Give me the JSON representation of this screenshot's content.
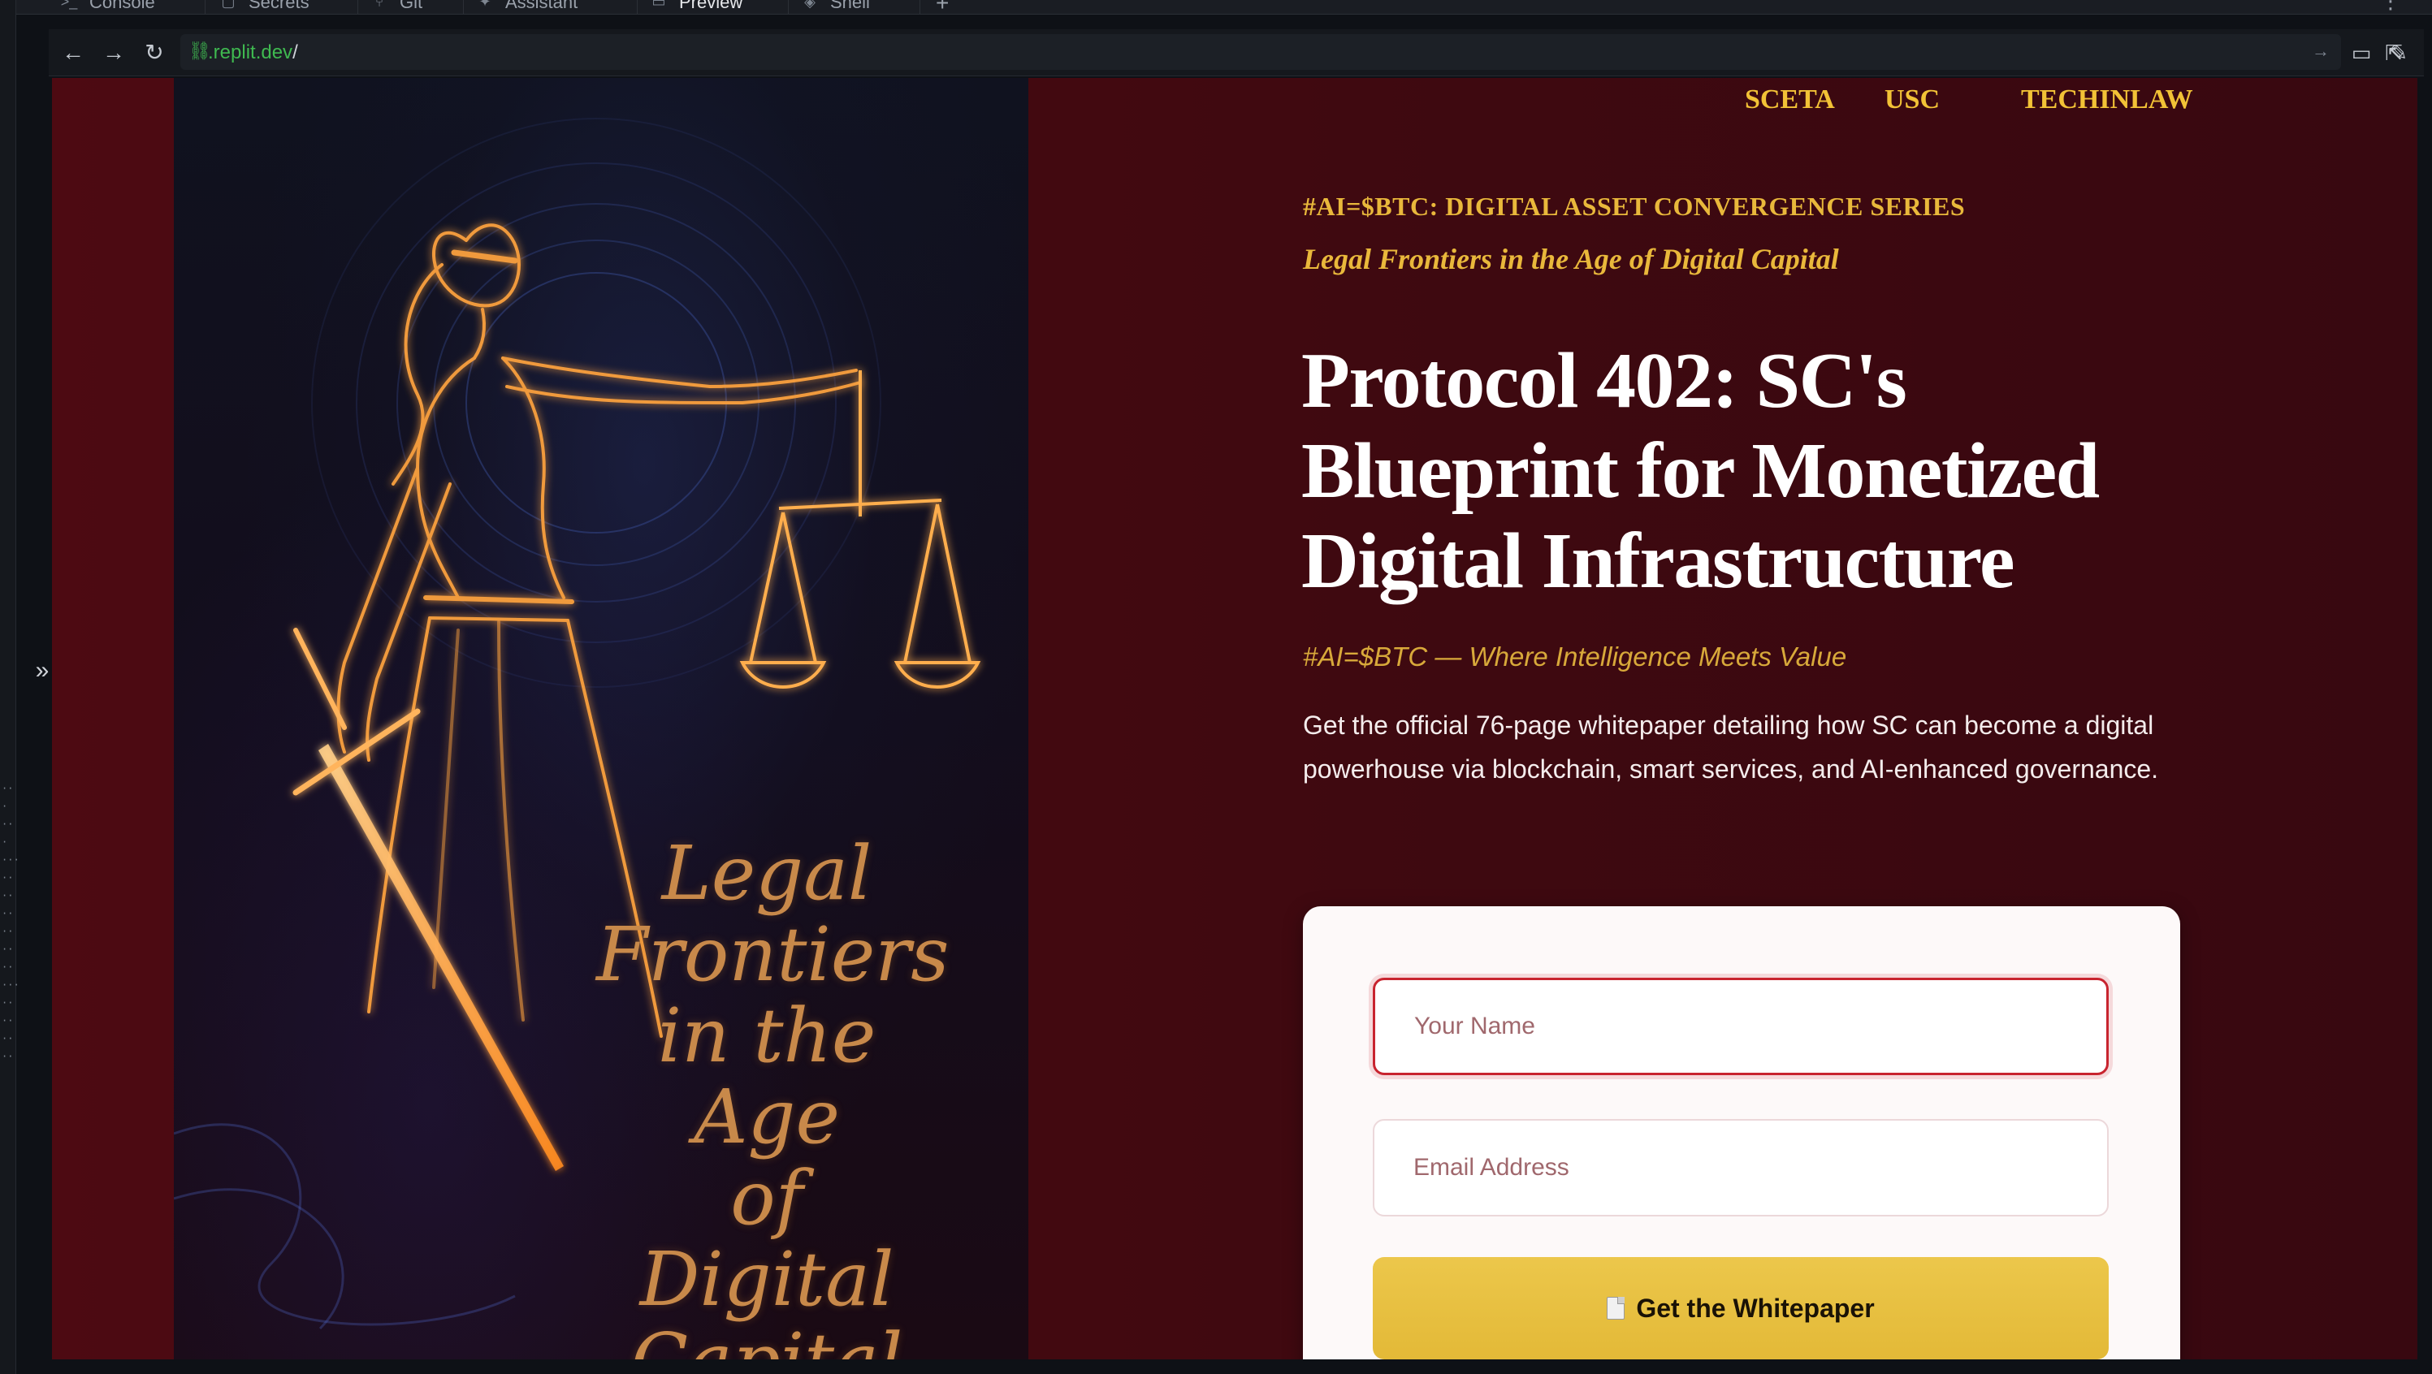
{
  "ide": {
    "tabs": [
      {
        "label": "Console",
        "icon": "terminal-icon"
      },
      {
        "label": "Secrets",
        "icon": "lock-icon"
      },
      {
        "label": "Git",
        "icon": "git-branch-icon"
      },
      {
        "label": "Assistant",
        "icon": "sparkle-icon"
      },
      {
        "label": "Preview",
        "icon": "monitor-icon",
        "active": true
      },
      {
        "label": "Shell",
        "icon": "shell-icon"
      }
    ],
    "add_tab": "+",
    "menu": "⋮",
    "url": {
      "domain": ".replit.dev",
      "path": "/"
    }
  },
  "site": {
    "nav": [
      "SCETA",
      "USC",
      "TECHINLAW"
    ],
    "art_caption": [
      "Legal",
      "Frontiers",
      "in the Age",
      "of Digital",
      "Capital"
    ],
    "kicker": "#AI=$BTC: DIGITAL ASSET CONVERGENCE SERIES",
    "kicker_sub": "Legal Frontiers in the Age of Digital Capital",
    "headline": "Protocol 402: SC's Blueprint for Monetized Digital Infrastructure",
    "tagline": "#AI=$BTC — Where Intelligence Meets Value",
    "description": "Get the official 76-page whitepaper detailing how SC can become a digital powerhouse via blockchain, smart services, and AI-enhanced governance.",
    "form": {
      "name_placeholder": "Your Name",
      "email_placeholder": "Email Address",
      "submit_label": "Get the Whitepaper"
    }
  },
  "colors": {
    "page_background": "#4d0a12",
    "accent_gold": "#f2c236",
    "button_gold": "#e3b937",
    "focus_red": "#c8242f",
    "url_green": "#3fb950"
  }
}
